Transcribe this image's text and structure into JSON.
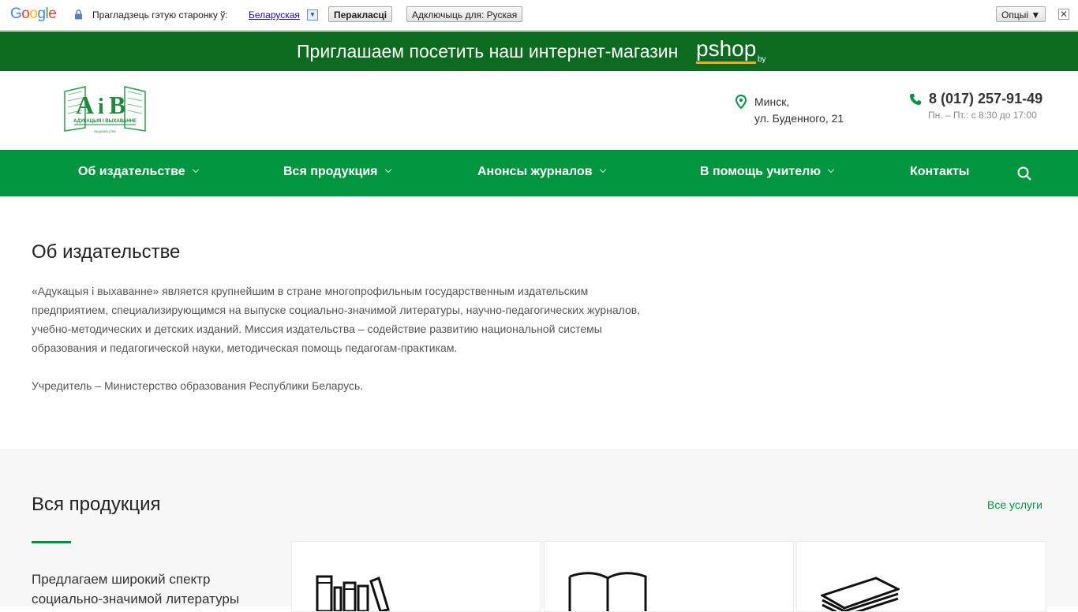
{
  "translate_bar": {
    "logo": "Google",
    "prompt": "Прагладзець гэтую старонку ў:",
    "language": "Беларуская",
    "translate_button": "Перакласці",
    "disable_button": "Адключыць для: Руская",
    "options_button": "Опцыі ▼",
    "close_glyph": "✕"
  },
  "promo": {
    "text": "Приглашаем посетить наш интернет-магазин",
    "brand": "pshop",
    "brand_suffix": "by"
  },
  "header": {
    "address_line1": "Минск,",
    "address_line2": "ул. Буденного, 21",
    "phone": "8 (017) 257-91-49",
    "hours": "Пн. – Пт.: с 8:30 до 17:00"
  },
  "nav": {
    "items": [
      {
        "label": "Об издательстве"
      },
      {
        "label": "Вся продукция"
      },
      {
        "label": "Анонсы журналов"
      },
      {
        "label": "В помощь учителю"
      },
      {
        "label": "Контакты"
      }
    ]
  },
  "about": {
    "title": "Об издательстве",
    "lines": [
      "«Адукацыя і выхаванне» является  крупнейшим в стране многопрофильным государственным издательским",
      "предприятием, специализирующимся на выпуске социально-значимой литературы,  научно-педагогических журналов,",
      "учебно-методических и детских изданий. Миссия издательства – содействие развитию национальной системы",
      "образования и педагогической науки, методическая помощь педагогам-практикам."
    ],
    "founder": "Учредитель – Министерство образования Республики Беларусь."
  },
  "products": {
    "title": "Вся продукция",
    "all_link": "Все услуги",
    "description_line1": "Предлагаем широкий спектр",
    "description_line2": "социально-значимой литературы"
  },
  "colors": {
    "brand_green": "#009640",
    "promo_green": "#0d6b1f",
    "accent_orange": "#f5a623"
  }
}
